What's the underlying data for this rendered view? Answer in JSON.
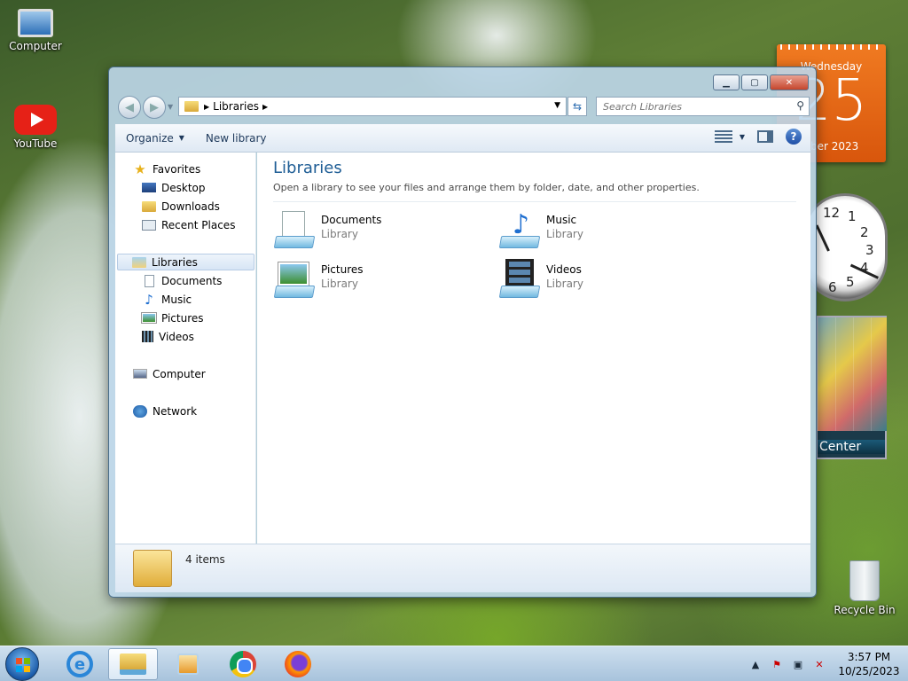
{
  "desktop": {
    "icons": [
      {
        "label": "Computer",
        "icon": "computer-icon"
      },
      {
        "label": "YouTube",
        "icon": "youtube-icon"
      },
      {
        "label": "Recycle Bin",
        "icon": "recycle-bin-icon"
      }
    ]
  },
  "gadgets": {
    "calendar": {
      "weekday": "Wednesday",
      "day": "25",
      "month_year": "ober 2023"
    },
    "clock": {
      "numerals": [
        "12",
        "1",
        "2",
        "3",
        "4",
        "5",
        "6"
      ]
    },
    "media_center": {
      "label": "Center"
    }
  },
  "window": {
    "address": {
      "crumb": "Libraries"
    },
    "search": {
      "placeholder": "Search Libraries"
    },
    "toolbar": {
      "organize": "Organize",
      "new_library": "New library"
    },
    "nav": {
      "favorites": {
        "label": "Favorites",
        "items": [
          "Desktop",
          "Downloads",
          "Recent Places"
        ]
      },
      "libraries": {
        "label": "Libraries",
        "items": [
          "Documents",
          "Music",
          "Pictures",
          "Videos"
        ]
      },
      "computer": "Computer",
      "network": "Network"
    },
    "content": {
      "title": "Libraries",
      "subtitle": "Open a library to see your files and arrange them by folder, date, and other properties.",
      "libraries": [
        {
          "name": "Documents",
          "type": "Library",
          "icon": "documents-library-icon"
        },
        {
          "name": "Music",
          "type": "Library",
          "icon": "music-library-icon"
        },
        {
          "name": "Pictures",
          "type": "Library",
          "icon": "pictures-library-icon"
        },
        {
          "name": "Videos",
          "type": "Library",
          "icon": "videos-library-icon"
        }
      ]
    },
    "details": {
      "count": "4 items"
    }
  },
  "taskbar": {
    "apps": [
      "Internet Explorer",
      "Windows Explorer",
      "Windows Media Player",
      "Google Chrome",
      "Firefox"
    ],
    "clock": {
      "time": "3:57 PM",
      "date": "10/25/2023"
    }
  },
  "colors": {
    "accent": "#1e5d95",
    "calendar": "#e8650f",
    "close_button": "#c5462d"
  }
}
